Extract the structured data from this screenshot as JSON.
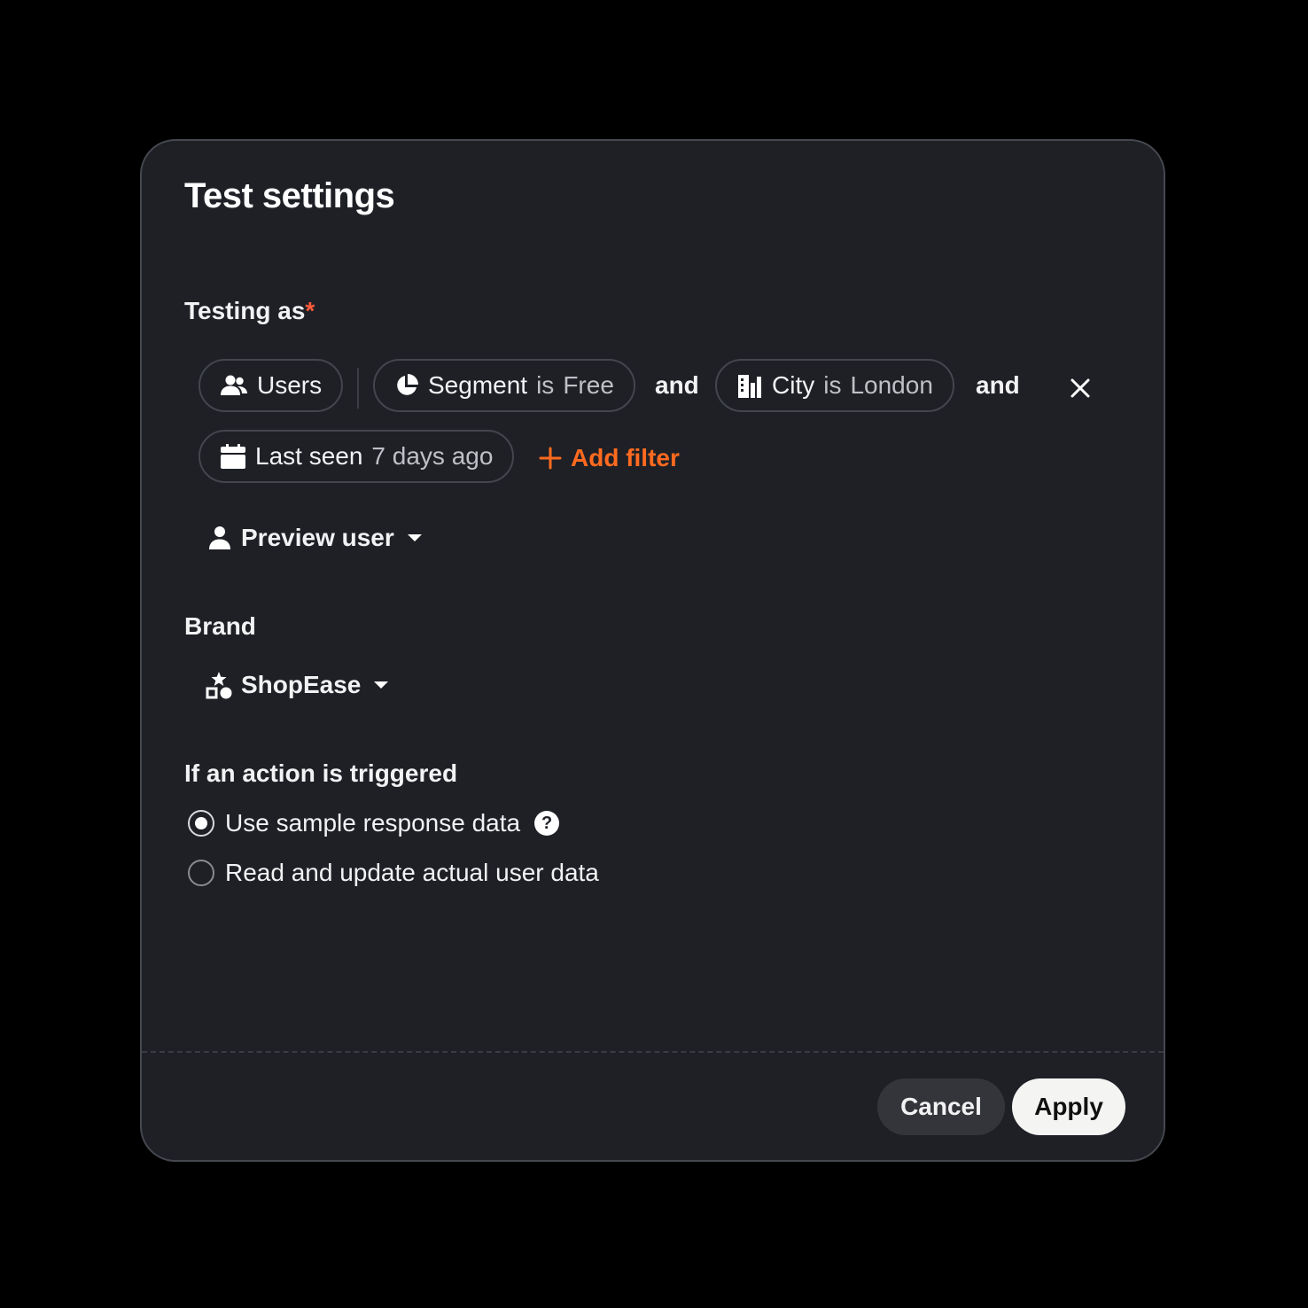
{
  "dialog": {
    "title": "Test settings"
  },
  "testing_as": {
    "label": "Testing as",
    "required_mark": "*",
    "filters": {
      "users": {
        "label": "Users",
        "icon": "users-icon"
      },
      "segment": {
        "field": "Segment",
        "op": "is",
        "value": "Free",
        "icon": "pie-chart-icon"
      },
      "city": {
        "field": "City",
        "op": "is",
        "value": "London",
        "icon": "building-icon"
      },
      "last_seen": {
        "field": "Last seen",
        "value": "7 days ago",
        "icon": "calendar-icon"
      }
    },
    "conjunction_1": "and",
    "conjunction_2": "and",
    "add_filter_label": "Add filter",
    "preview_user_label": "Preview user"
  },
  "brand": {
    "label": "Brand",
    "selected": "ShopEase"
  },
  "action": {
    "label": "If an action is triggered",
    "options": [
      {
        "label": "Use sample response data",
        "checked": true
      },
      {
        "label": "Read and update actual user data",
        "checked": false
      }
    ],
    "help_glyph": "?"
  },
  "footer": {
    "cancel_label": "Cancel",
    "apply_label": "Apply"
  },
  "colors": {
    "accent": "#ff6a1f",
    "required": "#ff5a3c",
    "dialog_bg": "#1e2026",
    "page_bg": "#000000"
  }
}
